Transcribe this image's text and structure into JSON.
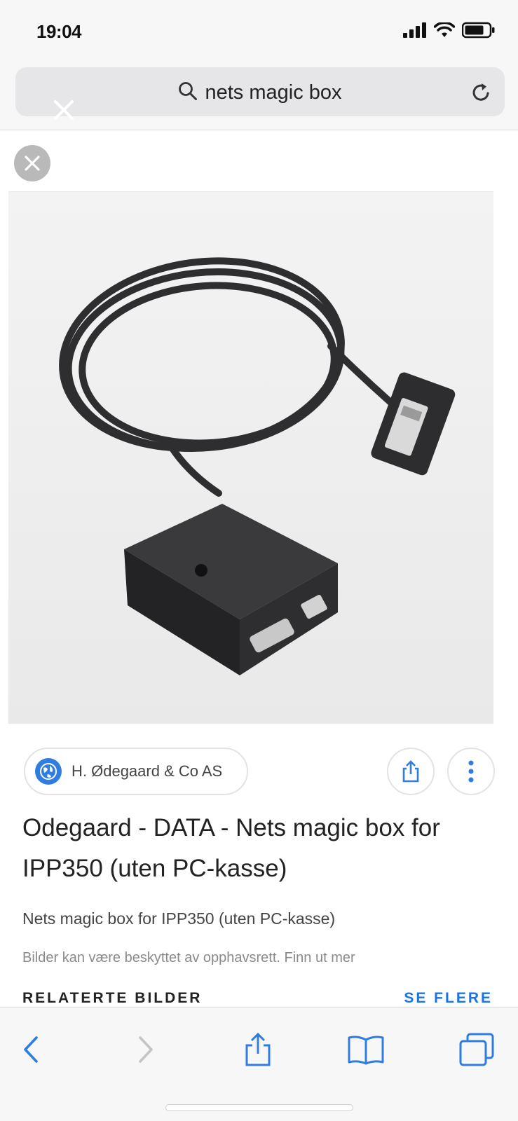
{
  "status_bar": {
    "time": "19:04"
  },
  "browser": {
    "search_query": "nets magic box"
  },
  "result": {
    "source_name": "H. Ødegaard & Co AS",
    "title": "Odegaard - DATA - Nets magic box for IPP350 (uten PC-kasse)",
    "subtitle": "Nets magic box for IPP350 (uten PC-kasse)",
    "copyright_notice": "Bilder kan være beskyttet av opphavsrett. Finn ut mer",
    "related_label": "RELATERTE BILDER",
    "see_more_label": "SE FLERE"
  },
  "colors": {
    "accent": "#1a73e8",
    "globe": "#2f7de1",
    "bar_background": "#f7f7f7",
    "ios_blue": "#2f7de1"
  },
  "icons": {
    "status": [
      "cellular-signal-icon",
      "wifi-icon",
      "battery-icon"
    ],
    "url_bar": [
      "search-icon",
      "close-icon",
      "reload-icon"
    ],
    "result": [
      "globe-icon",
      "share-icon",
      "more-vertical-icon"
    ],
    "toolbar": [
      "back-icon",
      "forward-icon",
      "share-icon",
      "bookmarks-icon",
      "tabs-icon"
    ]
  }
}
